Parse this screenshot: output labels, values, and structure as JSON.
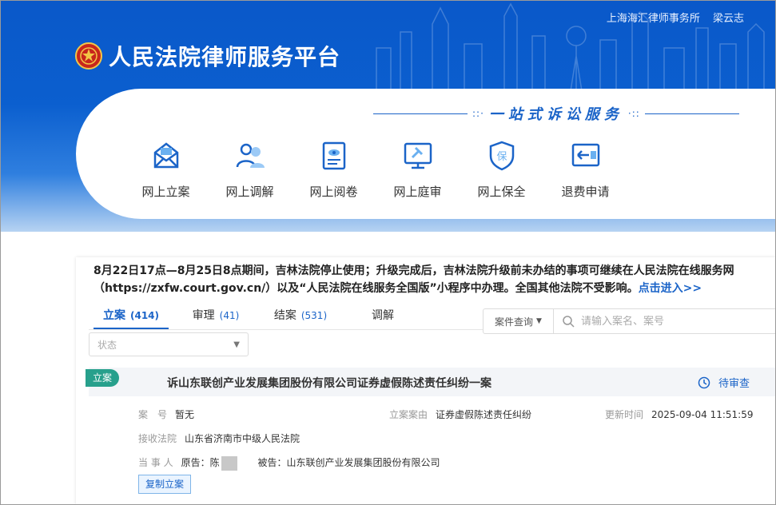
{
  "header": {
    "org_name": "上海海汇律师事务所",
    "user_name": "梁云志",
    "platform_title": "人民法院律师服务平台",
    "slogan": "一站式诉讼服务",
    "bg_color": "#0b5fcf"
  },
  "services": [
    {
      "label": "网上立案",
      "icon": "envelope-icon"
    },
    {
      "label": "网上调解",
      "icon": "people-icon"
    },
    {
      "label": "网上阅卷",
      "icon": "document-eye-icon"
    },
    {
      "label": "网上庭审",
      "icon": "gavel-screen-icon"
    },
    {
      "label": "网上保全",
      "icon": "shield-bao-icon"
    },
    {
      "label": "退费申请",
      "icon": "refund-card-icon"
    }
  ],
  "notice": {
    "text": "8月22日17点—8月25日8点期间，吉林法院停止使用；升级完成后，吉林法院升级前未办结的事项可继续在人民法院在线服务网（https://zxfw.court.gov.cn/）以及“人民法院在线服务全国版”小程序中办理。全国其他法院不受影响。",
    "link_text": "点击进入>>"
  },
  "tabs": [
    {
      "label": "立案",
      "count": "(414)"
    },
    {
      "label": "审理",
      "count": "(41)"
    },
    {
      "label": "结案",
      "count": "(531)"
    },
    {
      "label": "调解",
      "count": ""
    }
  ],
  "search": {
    "query_type": "案件查询",
    "placeholder": "请输入案名、案号"
  },
  "filter": {
    "status_placeholder": "状态"
  },
  "case": {
    "tag": "立案",
    "title": "诉山东联创产业发展集团股份有限公司证券虚假陈述责任纠纷一案",
    "status": "待审查",
    "case_no_label": "案　号",
    "case_no_value": "暂无",
    "cause_label": "立案案由",
    "cause_value": "证券虚假陈述责任纠纷",
    "updated_label": "更新时间",
    "updated_value": "2025-09-04 11:51:59",
    "court_label": "接收法院",
    "court_value": "山东省济南市中级人民法院",
    "party_label": "当 事 人",
    "plaintiff_label": "原告：",
    "plaintiff_value": "陈",
    "defendant_label": "被告：",
    "defendant_value": "山东联创产业发展集团股份有限公司",
    "copy_button": "复制立案",
    "tag_color": "#27a08c"
  }
}
